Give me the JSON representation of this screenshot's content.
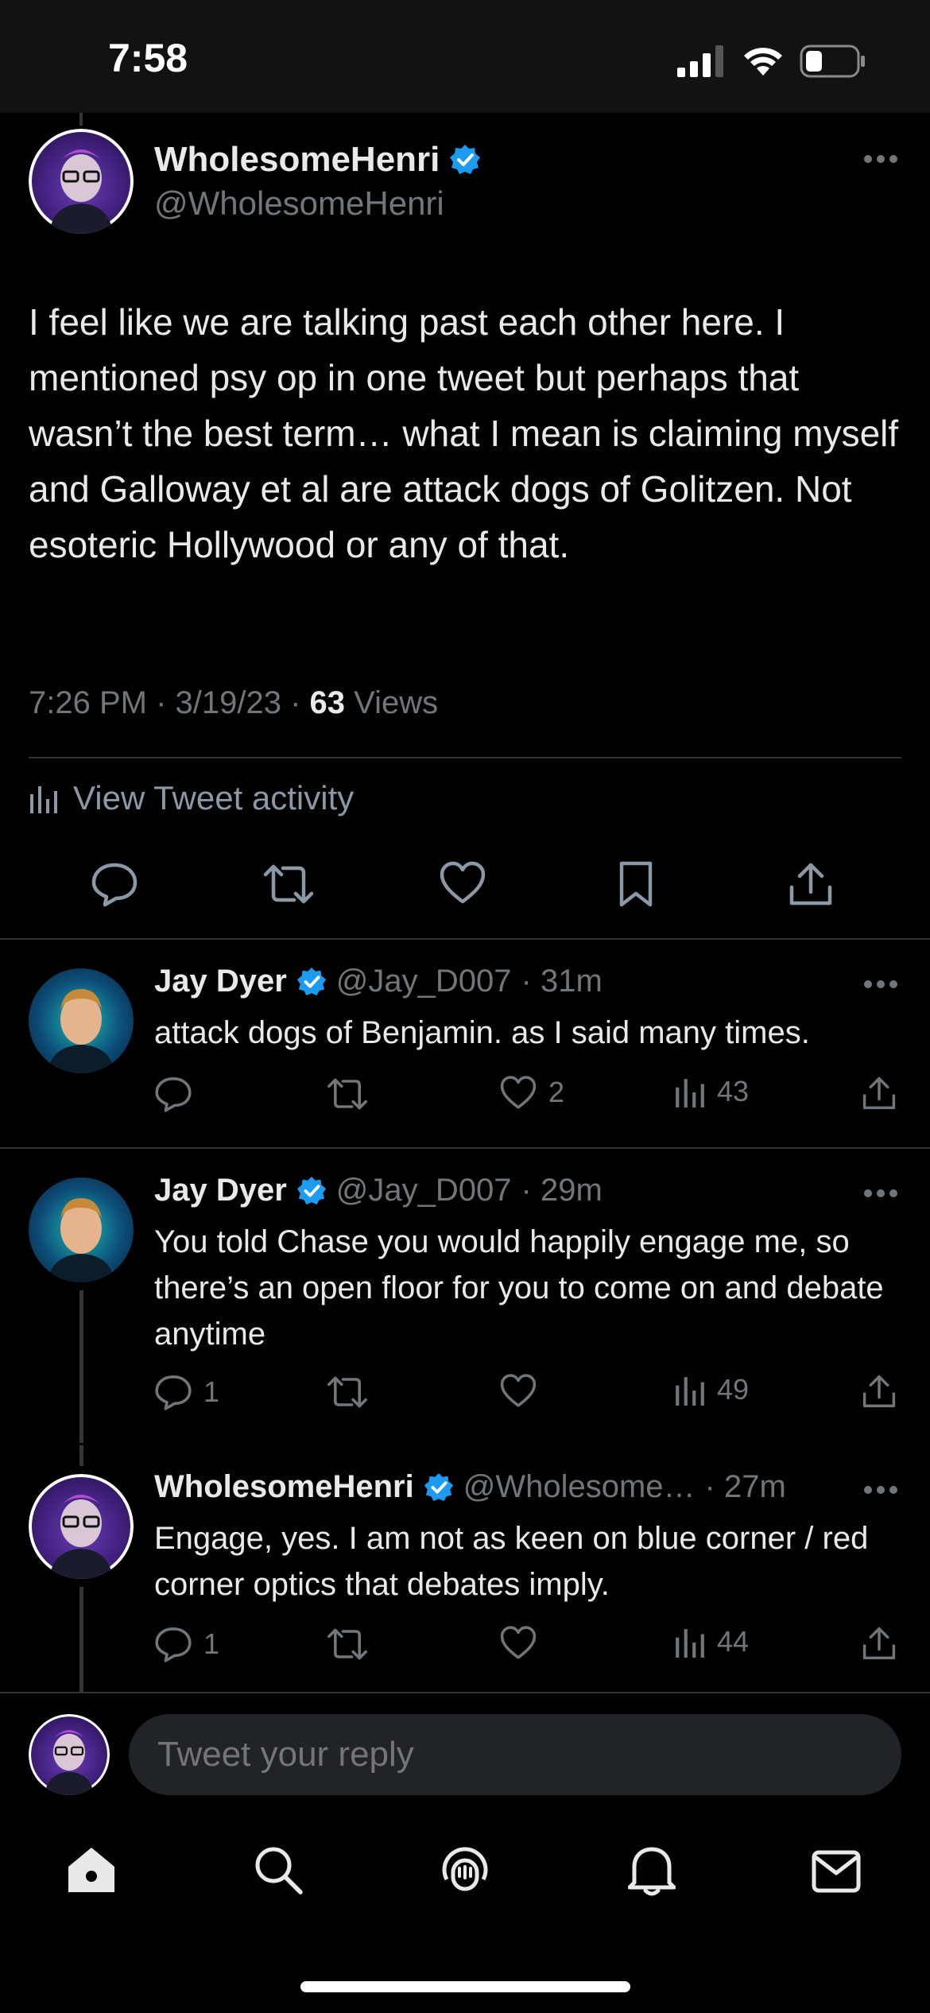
{
  "status_bar": {
    "time": "7:58"
  },
  "main_tweet": {
    "display_name": "WholesomeHenri",
    "handle": "@WholesomeHenri",
    "body": "I feel like we are talking past each other here. I mentioned psy op in one tweet but perhaps that wasn’t the best term… what I mean is claiming myself and Galloway et al are attack dogs of Golitzen. Not esoteric Hollywood or any of that.",
    "timestamp": "7:26 PM · 3/19/23 · ",
    "views_count": "63",
    "views_label": " Views",
    "activity_label": "View Tweet activity"
  },
  "replies": [
    {
      "display_name": "Jay Dyer",
      "handle": "@Jay_D007",
      "time": "· 31m",
      "text": "attack dogs of Benjamin. as I said many times.",
      "reply_count": "",
      "like_count": "2",
      "views": "43"
    },
    {
      "display_name": "Jay Dyer",
      "handle": "@Jay_D007",
      "time": "· 29m",
      "text": "You told Chase you would happily engage me, so there’s an open floor for you to come on and debate anytime",
      "reply_count": "1",
      "like_count": "",
      "views": "49"
    },
    {
      "display_name": "WholesomeHenri",
      "handle": "@Wholesome…",
      "time": "· 27m",
      "text": "Engage, yes. I am not as keen on blue corner / red corner optics that debates imply.",
      "reply_count": "1",
      "like_count": "",
      "views": "44"
    }
  ],
  "reply_box": {
    "placeholder": "Tweet your reply"
  },
  "colors": {
    "verified": "#1d9bf0",
    "background": "#000000",
    "muted": "#71767b"
  },
  "icons": [
    "home-icon",
    "search-icon",
    "spaces-icon",
    "notifications-icon",
    "messages-icon"
  ]
}
